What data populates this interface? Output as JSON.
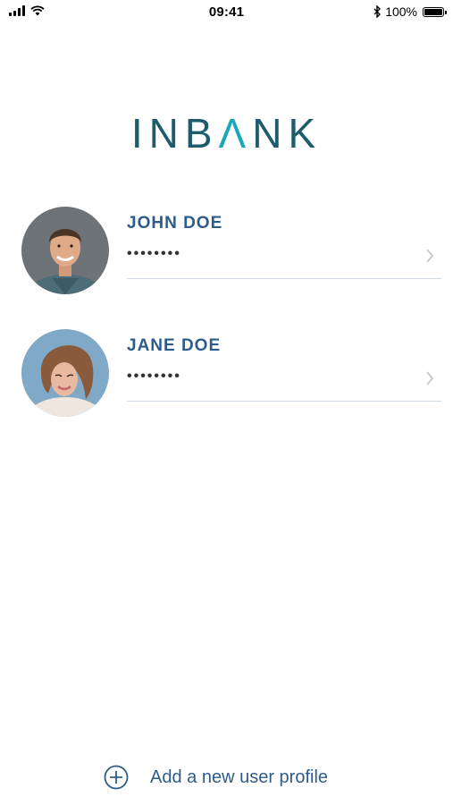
{
  "status_bar": {
    "time": "09:41",
    "battery": "100%",
    "icons": [
      "signal-icon",
      "wifi-icon",
      "bluetooth-icon",
      "battery-icon"
    ]
  },
  "logo": {
    "parts": [
      "INB",
      "Λ",
      "NK"
    ],
    "colors": {
      "main": "#1d5c6c",
      "accent": "#1aa7b8"
    }
  },
  "profiles": [
    {
      "name": "JOHN DOE",
      "password_mask": "••••••••"
    },
    {
      "name": "JANE DOE",
      "password_mask": "••••••••"
    }
  ],
  "add_profile": {
    "label": "Add a new user profile"
  },
  "colors": {
    "text_primary": "#2e5c8a",
    "divider": "#cfd8e0",
    "chevron": "#c7ccd1"
  }
}
